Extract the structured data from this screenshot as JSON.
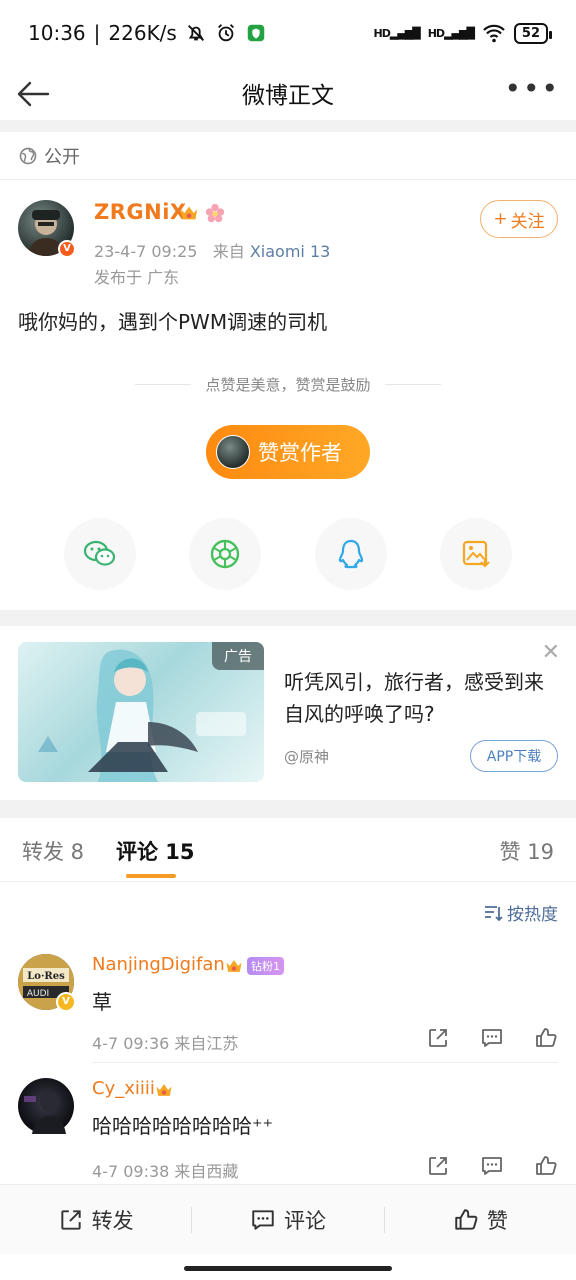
{
  "status_bar": {
    "time": "10:36",
    "speed": "226K/s",
    "sim1": "HD",
    "sim2": "HD",
    "battery": "52"
  },
  "nav": {
    "title": "微博正文"
  },
  "visibility": "公开",
  "post": {
    "author": "ZRGNiX",
    "date": "23-4-7 09:25",
    "from_prefix": "来自",
    "device": "Xiaomi 13",
    "location": "发布于 广东",
    "follow_label": "关注",
    "text": "哦你妈的，遇到个PWM调速的司机",
    "reward_tip": "点赞是美意，赞赏是鼓励",
    "reward_button": "赞赏作者"
  },
  "share": [
    {
      "name": "wechat-icon",
      "color": "#3cb371"
    },
    {
      "name": "moments-icon",
      "color": "#46c05a"
    },
    {
      "name": "qq-icon",
      "color": "#30a7e6"
    },
    {
      "name": "save-image-icon",
      "color": "#f5a623"
    }
  ],
  "ad": {
    "tag": "广告",
    "title": "听凭风引，旅行者，感受到来自风的呼唤了吗?",
    "source": "@原神",
    "download": "APP下载"
  },
  "tabs": {
    "repost": "转发 8",
    "comments": "评论 15",
    "likes": "赞 19"
  },
  "sort_label": "按热度",
  "comments": [
    {
      "user": "NanjingDigifan",
      "fan_badge": "钻粉1",
      "text": "草",
      "meta": "4-7 09:36  来自江苏",
      "avatar_text": "Lo-Res AUDI"
    },
    {
      "user": "Cy_xiiii",
      "text": "哈哈哈哈哈哈哈哈⁺⁺",
      "meta": "4-7 09:38  来自西藏"
    }
  ],
  "bottom_bar": {
    "repost": "转发",
    "comment": "评论",
    "like": "赞"
  },
  "colors": {
    "accent": "#f07a1e",
    "link": "#4d6d9a"
  }
}
